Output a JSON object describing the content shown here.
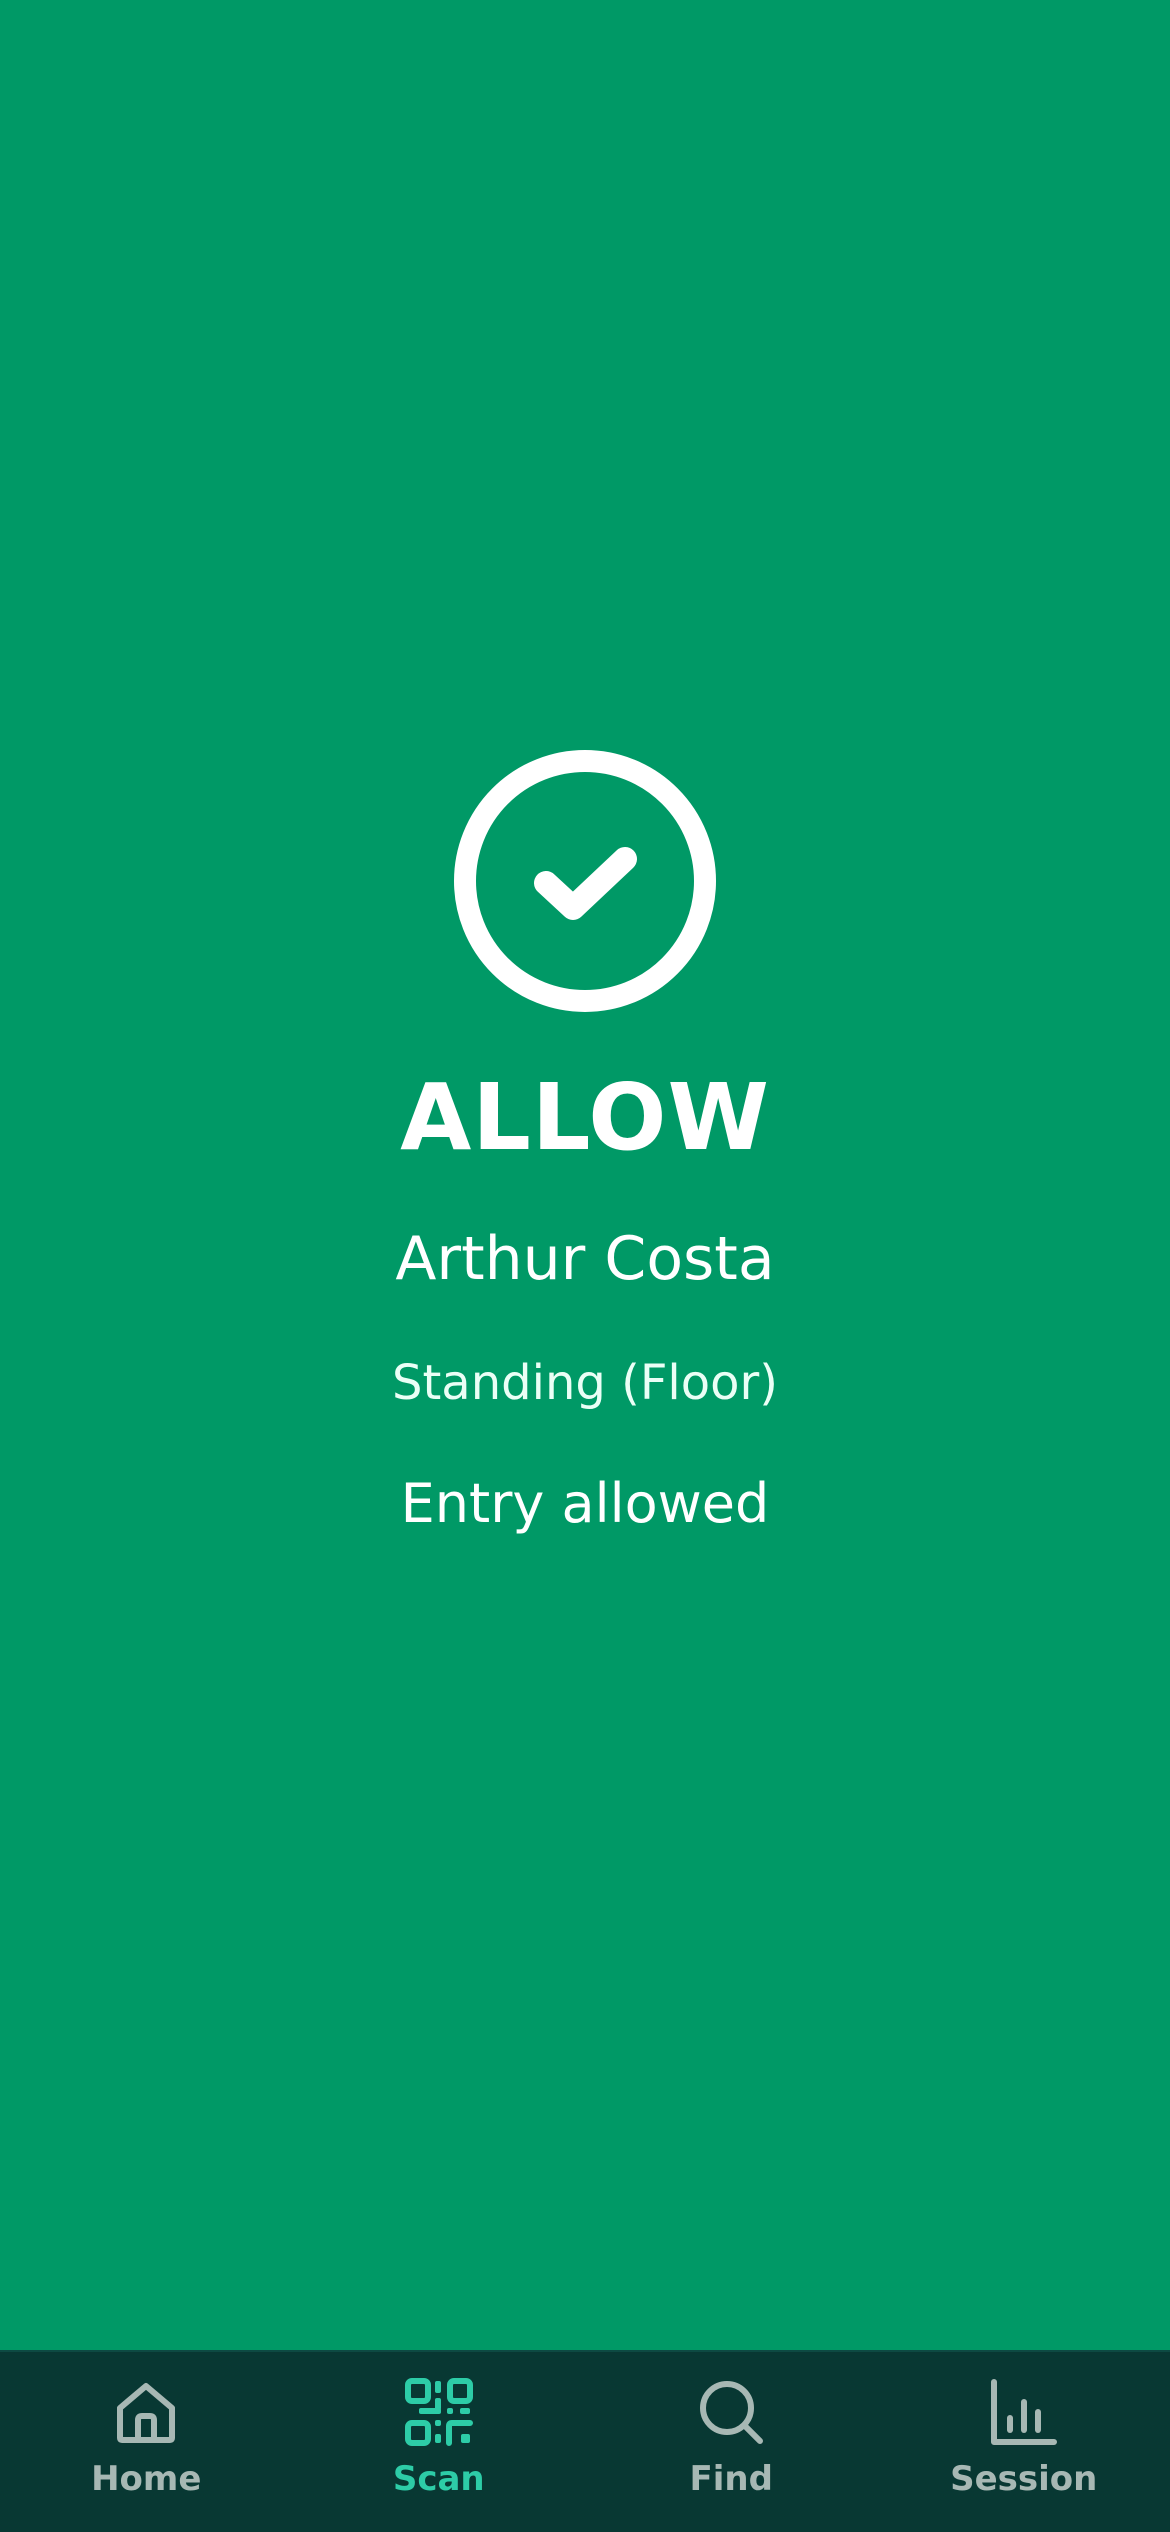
{
  "result": {
    "status": "ALLOW",
    "name": "Arthur Costa",
    "ticket_type": "Standing (Floor)",
    "message": "Entry allowed",
    "icon": "check-circle-icon",
    "background_color": "#009966"
  },
  "tabbar": {
    "active": "scan",
    "accent_color": "#2dcca7",
    "items": [
      {
        "id": "home",
        "label": "Home",
        "icon": "home-icon"
      },
      {
        "id": "scan",
        "label": "Scan",
        "icon": "qr-code-icon"
      },
      {
        "id": "find",
        "label": "Find",
        "icon": "search-icon"
      },
      {
        "id": "session",
        "label": "Session",
        "icon": "bar-chart-icon"
      }
    ]
  }
}
